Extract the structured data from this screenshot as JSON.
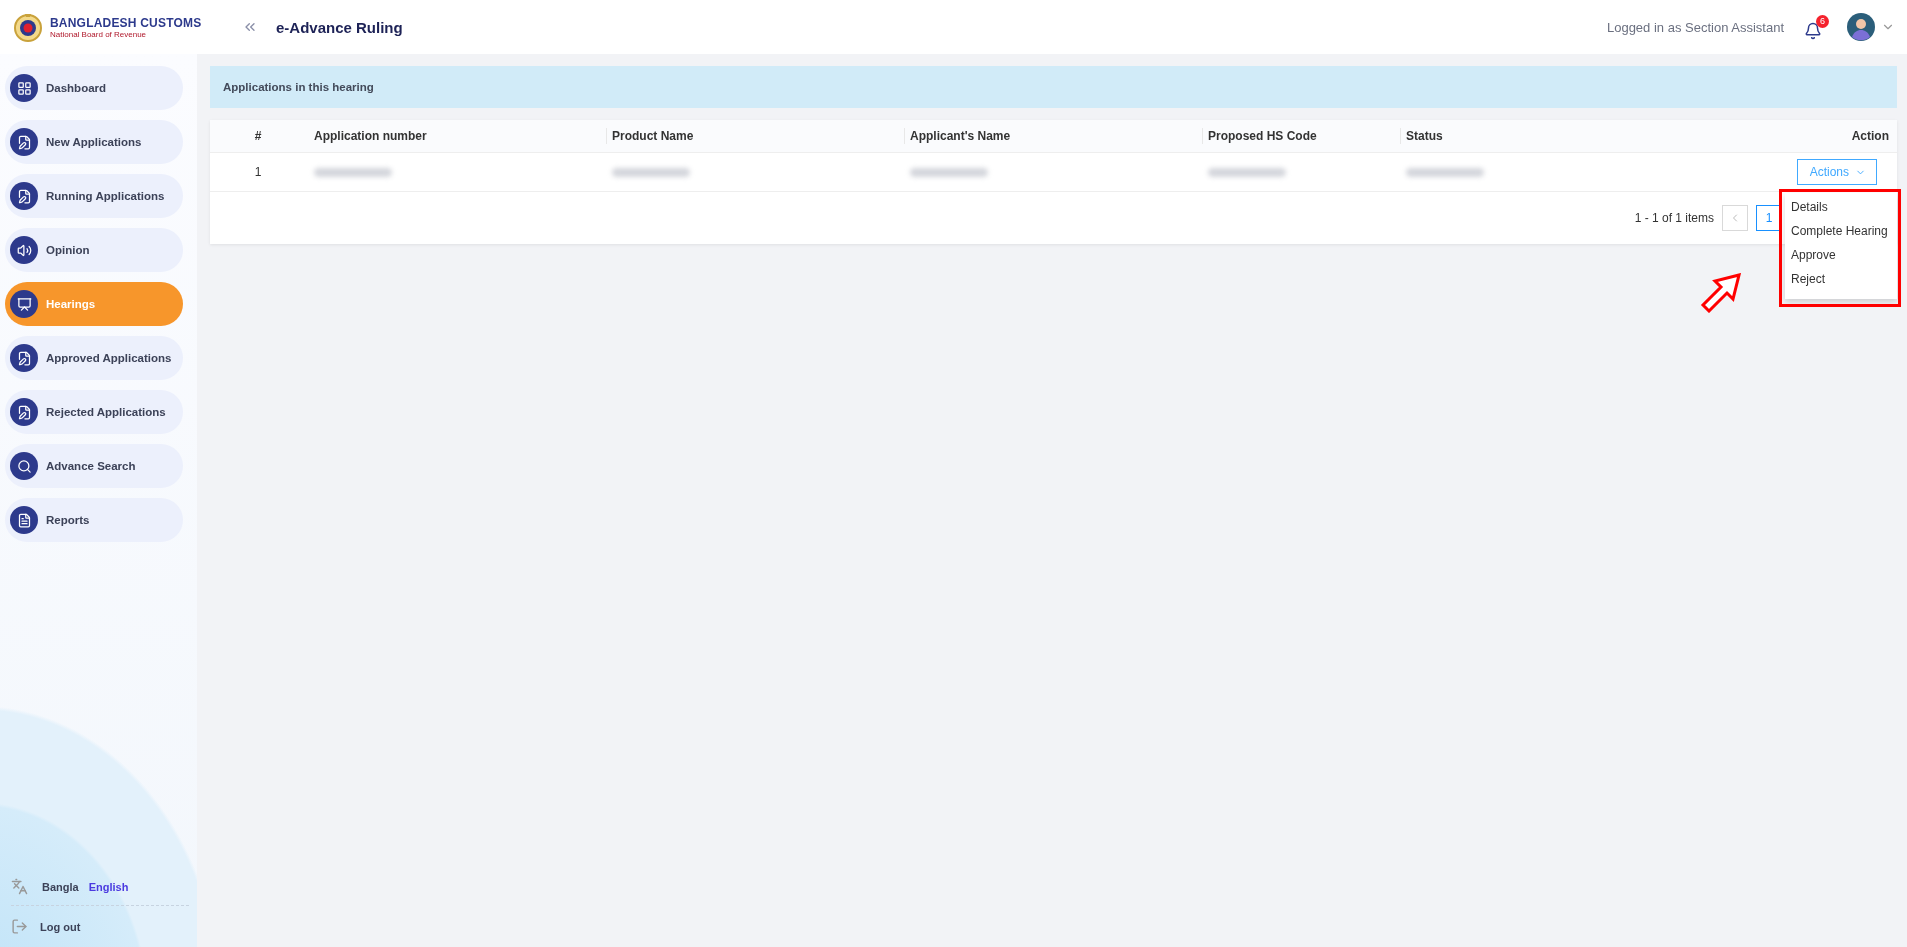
{
  "header": {
    "logo_title": "BANGLADESH CUSTOMS",
    "logo_subtitle": "National Board of Revenue",
    "app_title": "e-Advance Ruling",
    "user_label": "Logged in as Section Assistant",
    "notification_count": "6"
  },
  "sidebar": {
    "items": [
      {
        "label": "Dashboard",
        "selected": false
      },
      {
        "label": "New Applications",
        "selected": false
      },
      {
        "label": "Running Applications",
        "selected": false
      },
      {
        "label": "Opinion",
        "selected": false
      },
      {
        "label": "Hearings",
        "selected": true
      },
      {
        "label": "Approved Applications",
        "selected": false
      },
      {
        "label": "Rejected Applications",
        "selected": false
      },
      {
        "label": "Advance Search",
        "selected": false
      },
      {
        "label": "Reports",
        "selected": false
      }
    ],
    "languages": [
      {
        "label": "Bangla",
        "selected": false
      },
      {
        "label": "English",
        "selected": true
      }
    ],
    "logout": "Log out"
  },
  "panel": {
    "title": "Applications in this hearing"
  },
  "table": {
    "columns": [
      "#",
      "Application number",
      "Product Name",
      "Applicant's Name",
      "Proposed HS Code",
      "Status",
      "Action"
    ],
    "rows": [
      {
        "cells": [
          {
            "kind": "text",
            "text": "1"
          },
          {
            "kind": "blurred"
          },
          {
            "kind": "blurred"
          },
          {
            "kind": "blurred"
          },
          {
            "kind": "blurred"
          },
          {
            "kind": "blurred"
          }
        ],
        "action": "Actions"
      }
    ]
  },
  "menu": {
    "open": true,
    "items": [
      "Details",
      "Complete Hearing",
      "Approve",
      "Reject"
    ]
  },
  "pagination": {
    "summary": "1 - 1 of 1 items",
    "pages": [
      {
        "label": "1",
        "selected": true
      }
    ]
  }
}
